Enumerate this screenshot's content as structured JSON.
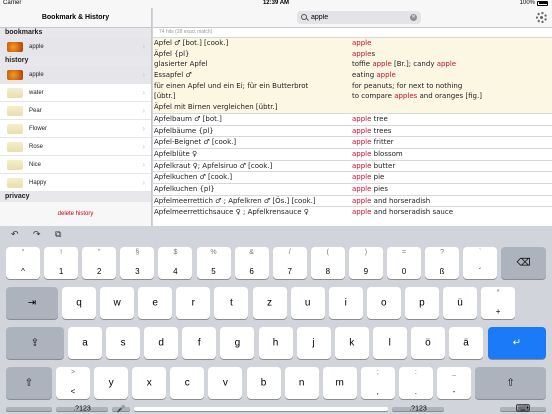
{
  "status": {
    "carrier": "Carrier",
    "time": "12:39 AM",
    "battery": "100%"
  },
  "sidebar": {
    "title": "Bookmark & History",
    "bookmarks_header": "bookmarks",
    "bookmarks": [
      {
        "label": "apple",
        "thumb": "apple"
      }
    ],
    "history_header": "history",
    "history": [
      {
        "label": "apple",
        "thumb": "apple"
      },
      {
        "label": "water",
        "thumb": "light"
      },
      {
        "label": "Pear",
        "thumb": "light"
      },
      {
        "label": "Flower",
        "thumb": "light"
      },
      {
        "label": "Rose",
        "thumb": "light"
      },
      {
        "label": "Nice",
        "thumb": "light"
      },
      {
        "label": "Happy",
        "thumb": "light"
      }
    ],
    "privacy_header": "privacy",
    "delete_label": "delete history"
  },
  "search": {
    "value": "apple",
    "hits": "74 hits  (38 exact match)"
  },
  "results": [
    {
      "highlight": true,
      "de": [
        "Apfel ♂ [bot.] [cook.]",
        "Äpfel {pl}",
        "glasierter Apfel",
        "Essapfel ♂",
        "für einen Apfel und ein Ei; für ein Butterbrot",
        "[übtr.]",
        "Äpfel mit Birnen vergleichen [übtr.]"
      ],
      "en": [
        [
          [
            "apple",
            true
          ]
        ],
        [
          [
            "apple",
            true
          ],
          [
            "s",
            false
          ]
        ],
        [
          [
            "toffie ",
            false
          ],
          [
            "apple",
            true
          ],
          [
            " [Br.]; candy ",
            false
          ],
          [
            "apple",
            true
          ]
        ],
        [
          [
            "eating ",
            false
          ],
          [
            "apple",
            true
          ]
        ],
        [
          [
            "for peanuts; for next to nothing",
            false
          ]
        ],
        [
          [
            "to compare ",
            false
          ],
          [
            "apples",
            true
          ],
          [
            " and oranges [fig.]",
            false
          ]
        ]
      ]
    },
    {
      "highlight": false,
      "de": [
        "Apfelbaum ♂ [bot.]"
      ],
      "en": [
        [
          [
            "apple",
            true
          ],
          [
            " tree",
            false
          ]
        ]
      ]
    },
    {
      "highlight": false,
      "de": [
        "Apfelbäume {pl}"
      ],
      "en": [
        [
          [
            "apple",
            true
          ],
          [
            " trees",
            false
          ]
        ]
      ]
    },
    {
      "highlight": false,
      "de": [
        "Apfel-Beignet ♂ [cook.]"
      ],
      "en": [
        [
          [
            "apple",
            true
          ],
          [
            " fritter",
            false
          ]
        ]
      ]
    },
    {
      "highlight": false,
      "de": [
        "Apfelblüte ♀"
      ],
      "en": [
        [
          [
            "apple",
            true
          ],
          [
            " blossom",
            false
          ]
        ]
      ]
    },
    {
      "highlight": false,
      "de": [
        "Apfelkraut ♀; Apfelsiruo ♂ [cook.]"
      ],
      "en": [
        [
          [
            "apple",
            true
          ],
          [
            " butter",
            false
          ]
        ]
      ]
    },
    {
      "highlight": false,
      "de": [
        "Apfelkuchen ♂  [cook.]"
      ],
      "en": [
        [
          [
            "apple",
            true
          ],
          [
            " pie",
            false
          ]
        ]
      ]
    },
    {
      "highlight": false,
      "de": [
        "Apfelkuchen {pl}"
      ],
      "en": [
        [
          [
            "apple",
            true
          ],
          [
            " pies",
            false
          ]
        ]
      ]
    },
    {
      "highlight": false,
      "de": [
        "Apfelmeerrettich ♂ ; Apfelkren ♂ [Ös.] [cook.]"
      ],
      "en": [
        [
          [
            "apple",
            true
          ],
          [
            " and horseradish",
            false
          ]
        ]
      ]
    },
    {
      "highlight": false,
      "de": [
        "Apfelmeerrettichsauce ♀ ; Apfelkrensauce ♀"
      ],
      "en": [
        [
          [
            "apple",
            true
          ],
          [
            " and horseradish sauce",
            false
          ]
        ]
      ]
    }
  ],
  "keyboard": {
    "tools": [
      "↶",
      "↷",
      "⧉"
    ],
    "row1": [
      [
        "°",
        "^"
      ],
      [
        "!",
        "1"
      ],
      [
        "\"",
        "2"
      ],
      [
        "§",
        "3"
      ],
      [
        "$",
        "4"
      ],
      [
        "%",
        "5"
      ],
      [
        "&",
        "6"
      ],
      [
        "/",
        "7"
      ],
      [
        "(",
        "8"
      ],
      [
        ")",
        "9"
      ],
      [
        "=",
        "0"
      ],
      [
        "?",
        "ß"
      ],
      [
        "`",
        "´"
      ]
    ],
    "delete": "⌫",
    "tab": "⇥",
    "row2": [
      "q",
      "w",
      "e",
      "r",
      "t",
      "z",
      "u",
      "i",
      "o",
      "p",
      "ü"
    ],
    "row2_last": [
      "*",
      "+"
    ],
    "caps": "⇪",
    "row3": [
      "a",
      "s",
      "d",
      "f",
      "g",
      "h",
      "j",
      "k",
      "l",
      "ö",
      "ä"
    ],
    "return": "↵",
    "shift": "⇧",
    "row4_first": [
      ">",
      "<"
    ],
    "row4": [
      "y",
      "x",
      "c",
      "v",
      "b",
      "n",
      "m"
    ],
    "row4_punct": [
      [
        ";",
        ","
      ],
      [
        ":",
        "."
      ],
      [
        "_",
        "-"
      ]
    ],
    "numbers_label": ".?123",
    "mic": "🎤",
    "hide": "⌨"
  }
}
